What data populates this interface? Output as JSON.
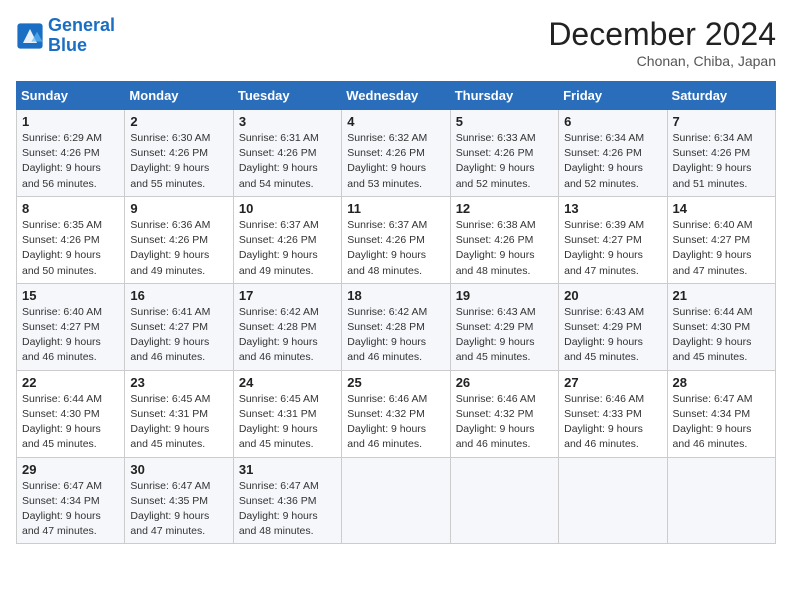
{
  "header": {
    "logo_line1": "General",
    "logo_line2": "Blue",
    "month_year": "December 2024",
    "location": "Chonan, Chiba, Japan"
  },
  "weekdays": [
    "Sunday",
    "Monday",
    "Tuesday",
    "Wednesday",
    "Thursday",
    "Friday",
    "Saturday"
  ],
  "weeks": [
    [
      {
        "day": 1,
        "sunrise": "6:29 AM",
        "sunset": "4:26 PM",
        "daylight": "9 hours and 56 minutes"
      },
      {
        "day": 2,
        "sunrise": "6:30 AM",
        "sunset": "4:26 PM",
        "daylight": "9 hours and 55 minutes"
      },
      {
        "day": 3,
        "sunrise": "6:31 AM",
        "sunset": "4:26 PM",
        "daylight": "9 hours and 54 minutes"
      },
      {
        "day": 4,
        "sunrise": "6:32 AM",
        "sunset": "4:26 PM",
        "daylight": "9 hours and 53 minutes"
      },
      {
        "day": 5,
        "sunrise": "6:33 AM",
        "sunset": "4:26 PM",
        "daylight": "9 hours and 52 minutes"
      },
      {
        "day": 6,
        "sunrise": "6:34 AM",
        "sunset": "4:26 PM",
        "daylight": "9 hours and 52 minutes"
      },
      {
        "day": 7,
        "sunrise": "6:34 AM",
        "sunset": "4:26 PM",
        "daylight": "9 hours and 51 minutes"
      }
    ],
    [
      {
        "day": 8,
        "sunrise": "6:35 AM",
        "sunset": "4:26 PM",
        "daylight": "9 hours and 50 minutes"
      },
      {
        "day": 9,
        "sunrise": "6:36 AM",
        "sunset": "4:26 PM",
        "daylight": "9 hours and 49 minutes"
      },
      {
        "day": 10,
        "sunrise": "6:37 AM",
        "sunset": "4:26 PM",
        "daylight": "9 hours and 49 minutes"
      },
      {
        "day": 11,
        "sunrise": "6:37 AM",
        "sunset": "4:26 PM",
        "daylight": "9 hours and 48 minutes"
      },
      {
        "day": 12,
        "sunrise": "6:38 AM",
        "sunset": "4:26 PM",
        "daylight": "9 hours and 48 minutes"
      },
      {
        "day": 13,
        "sunrise": "6:39 AM",
        "sunset": "4:27 PM",
        "daylight": "9 hours and 47 minutes"
      },
      {
        "day": 14,
        "sunrise": "6:40 AM",
        "sunset": "4:27 PM",
        "daylight": "9 hours and 47 minutes"
      }
    ],
    [
      {
        "day": 15,
        "sunrise": "6:40 AM",
        "sunset": "4:27 PM",
        "daylight": "9 hours and 46 minutes"
      },
      {
        "day": 16,
        "sunrise": "6:41 AM",
        "sunset": "4:27 PM",
        "daylight": "9 hours and 46 minutes"
      },
      {
        "day": 17,
        "sunrise": "6:42 AM",
        "sunset": "4:28 PM",
        "daylight": "9 hours and 46 minutes"
      },
      {
        "day": 18,
        "sunrise": "6:42 AM",
        "sunset": "4:28 PM",
        "daylight": "9 hours and 46 minutes"
      },
      {
        "day": 19,
        "sunrise": "6:43 AM",
        "sunset": "4:29 PM",
        "daylight": "9 hours and 45 minutes"
      },
      {
        "day": 20,
        "sunrise": "6:43 AM",
        "sunset": "4:29 PM",
        "daylight": "9 hours and 45 minutes"
      },
      {
        "day": 21,
        "sunrise": "6:44 AM",
        "sunset": "4:30 PM",
        "daylight": "9 hours and 45 minutes"
      }
    ],
    [
      {
        "day": 22,
        "sunrise": "6:44 AM",
        "sunset": "4:30 PM",
        "daylight": "9 hours and 45 minutes"
      },
      {
        "day": 23,
        "sunrise": "6:45 AM",
        "sunset": "4:31 PM",
        "daylight": "9 hours and 45 minutes"
      },
      {
        "day": 24,
        "sunrise": "6:45 AM",
        "sunset": "4:31 PM",
        "daylight": "9 hours and 45 minutes"
      },
      {
        "day": 25,
        "sunrise": "6:46 AM",
        "sunset": "4:32 PM",
        "daylight": "9 hours and 46 minutes"
      },
      {
        "day": 26,
        "sunrise": "6:46 AM",
        "sunset": "4:32 PM",
        "daylight": "9 hours and 46 minutes"
      },
      {
        "day": 27,
        "sunrise": "6:46 AM",
        "sunset": "4:33 PM",
        "daylight": "9 hours and 46 minutes"
      },
      {
        "day": 28,
        "sunrise": "6:47 AM",
        "sunset": "4:34 PM",
        "daylight": "9 hours and 46 minutes"
      }
    ],
    [
      {
        "day": 29,
        "sunrise": "6:47 AM",
        "sunset": "4:34 PM",
        "daylight": "9 hours and 47 minutes"
      },
      {
        "day": 30,
        "sunrise": "6:47 AM",
        "sunset": "4:35 PM",
        "daylight": "9 hours and 47 minutes"
      },
      {
        "day": 31,
        "sunrise": "6:47 AM",
        "sunset": "4:36 PM",
        "daylight": "9 hours and 48 minutes"
      },
      null,
      null,
      null,
      null
    ]
  ]
}
